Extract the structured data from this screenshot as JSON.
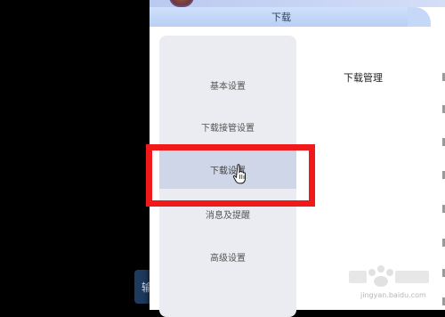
{
  "window": {
    "tab_title": "下载"
  },
  "sidebar": {
    "items": [
      {
        "label": "基本设置",
        "active": false
      },
      {
        "label": "下载接管设置",
        "active": false
      },
      {
        "label": "下载设置",
        "active": true
      },
      {
        "label": "消息及提醒",
        "active": false
      },
      {
        "label": "高级设置",
        "active": false
      }
    ]
  },
  "content": {
    "section_title": "下载管理"
  },
  "background": {
    "partial_button_text": "输"
  },
  "watermark": {
    "site": "jingyan.baidu.com"
  },
  "colors": {
    "highlight": "#f11a1a",
    "tab": "#c5d8f8",
    "sidebar_bg": "#ebecf1",
    "sidebar_active": "#cfd6e8"
  },
  "icons": [
    "hand-pointer-icon",
    "baidu-paw-icon"
  ]
}
